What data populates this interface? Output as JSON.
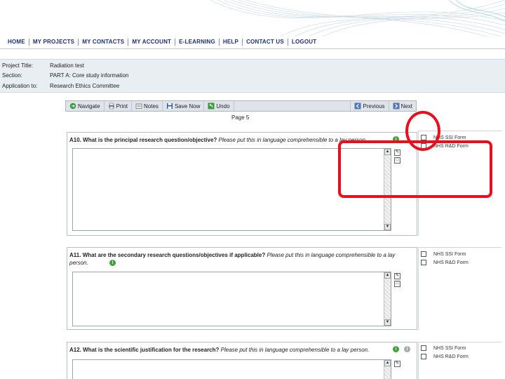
{
  "nav": [
    "HOME",
    "MY PROJECTS",
    "MY CONTACTS",
    "MY ACCOUNT",
    "E-LEARNING",
    "HELP",
    "CONTACT US",
    "LOGOUT"
  ],
  "project": {
    "title_label": "Project Title:",
    "title_value": "Radiation test",
    "section_label": "Section:",
    "section_value": "PART A: Core study information",
    "application_label": "Application to:",
    "application_value": "Research Ethics Committee"
  },
  "toolbar": {
    "navigate": "Navigate",
    "print": "Print",
    "notes": "Notes",
    "save_now": "Save Now",
    "undo": "Undo",
    "previous": "Previous",
    "next": "Next"
  },
  "page_label": "Page 5",
  "questions": [
    {
      "number": "A10.",
      "text": "What is the principal research question/objective?",
      "hint": "Please put this in language comprehensible to a lay person.",
      "value": ""
    },
    {
      "number": "A11.",
      "text": "What are the secondary research questions/objectives if applicable?",
      "hint": "Please put this in language comprehensible to a lay person.",
      "value": ""
    },
    {
      "number": "A12.",
      "text": "What is the scientific justification for the research?",
      "hint": "Please put this in language comprehensible to a lay person.",
      "value": ""
    }
  ],
  "form_options": [
    "NHS SSI Form",
    "NHS R&D Form"
  ],
  "colors": {
    "nav_text": "#1f2f7a",
    "highlight": "#e8101e",
    "info_band": "#e9eef2",
    "info_icon": "#3fa23a"
  }
}
